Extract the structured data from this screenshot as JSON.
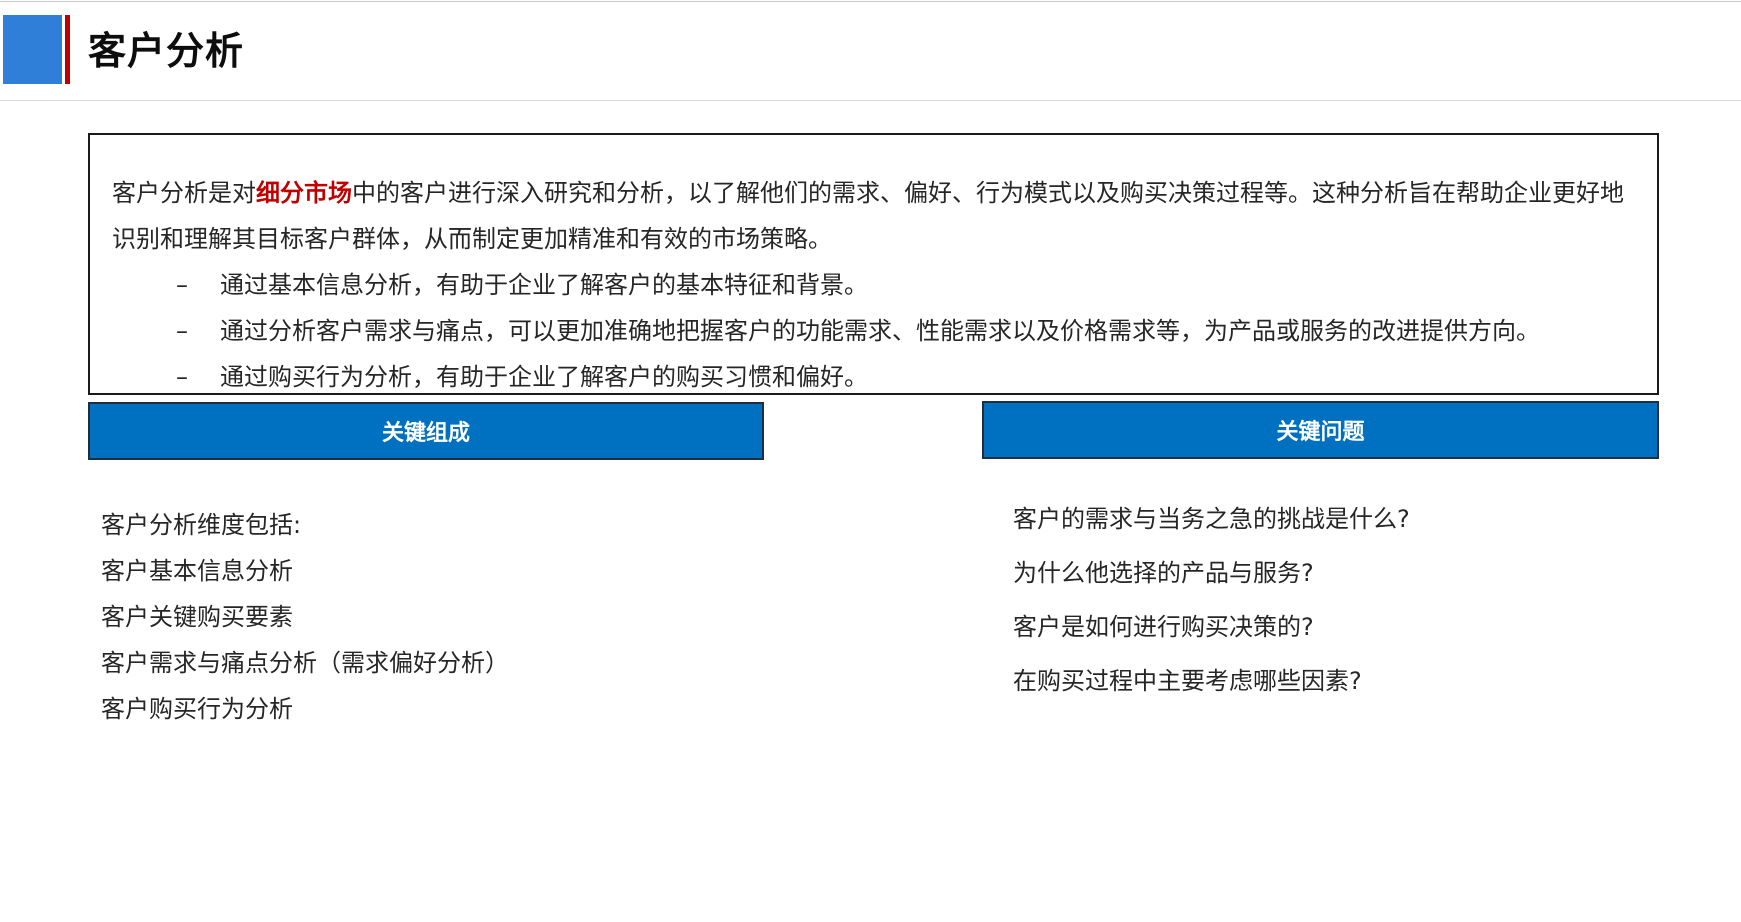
{
  "header": {
    "title": "客户分析"
  },
  "intro": {
    "para_prefix": "客户分析是对",
    "highlight": "细分市场",
    "para_suffix": "中的客户进行深入研究和分析，以了解他们的需求、偏好、行为模式以及购买决策过程等。这种分析旨在帮助企业更好地识别和理解其目标客户群体，从而制定更加精准和有效的市场策略。",
    "bullet_marker": "–",
    "bullets": [
      "通过基本信息分析，有助于企业了解客户的基本特征和背景。",
      "通过分析客户需求与痛点，可以更加准确地把握客户的功能需求、性能需求以及价格需求等，为产品或服务的改进提供方向。",
      "通过购买行为分析，有助于企业了解客户的购买习惯和偏好。"
    ]
  },
  "left_section": {
    "title": "关键组成",
    "items": [
      "客户分析维度包括:",
      "客户基本信息分析",
      "客户关键购买要素",
      "客户需求与痛点分析（需求偏好分析）",
      "客户购买行为分析"
    ]
  },
  "right_section": {
    "title": "关键问题",
    "items": [
      "客户的需求与当务之急的挑战是什么?",
      "为什么他选择的产品与服务?",
      "客户是如何进行购买决策的?",
      "在购买过程中主要考虑哪些因素?"
    ]
  },
  "colors": {
    "accent_blue": "#0070c0",
    "header_block_blue": "#2f7ed8",
    "accent_red": "#c00000"
  }
}
